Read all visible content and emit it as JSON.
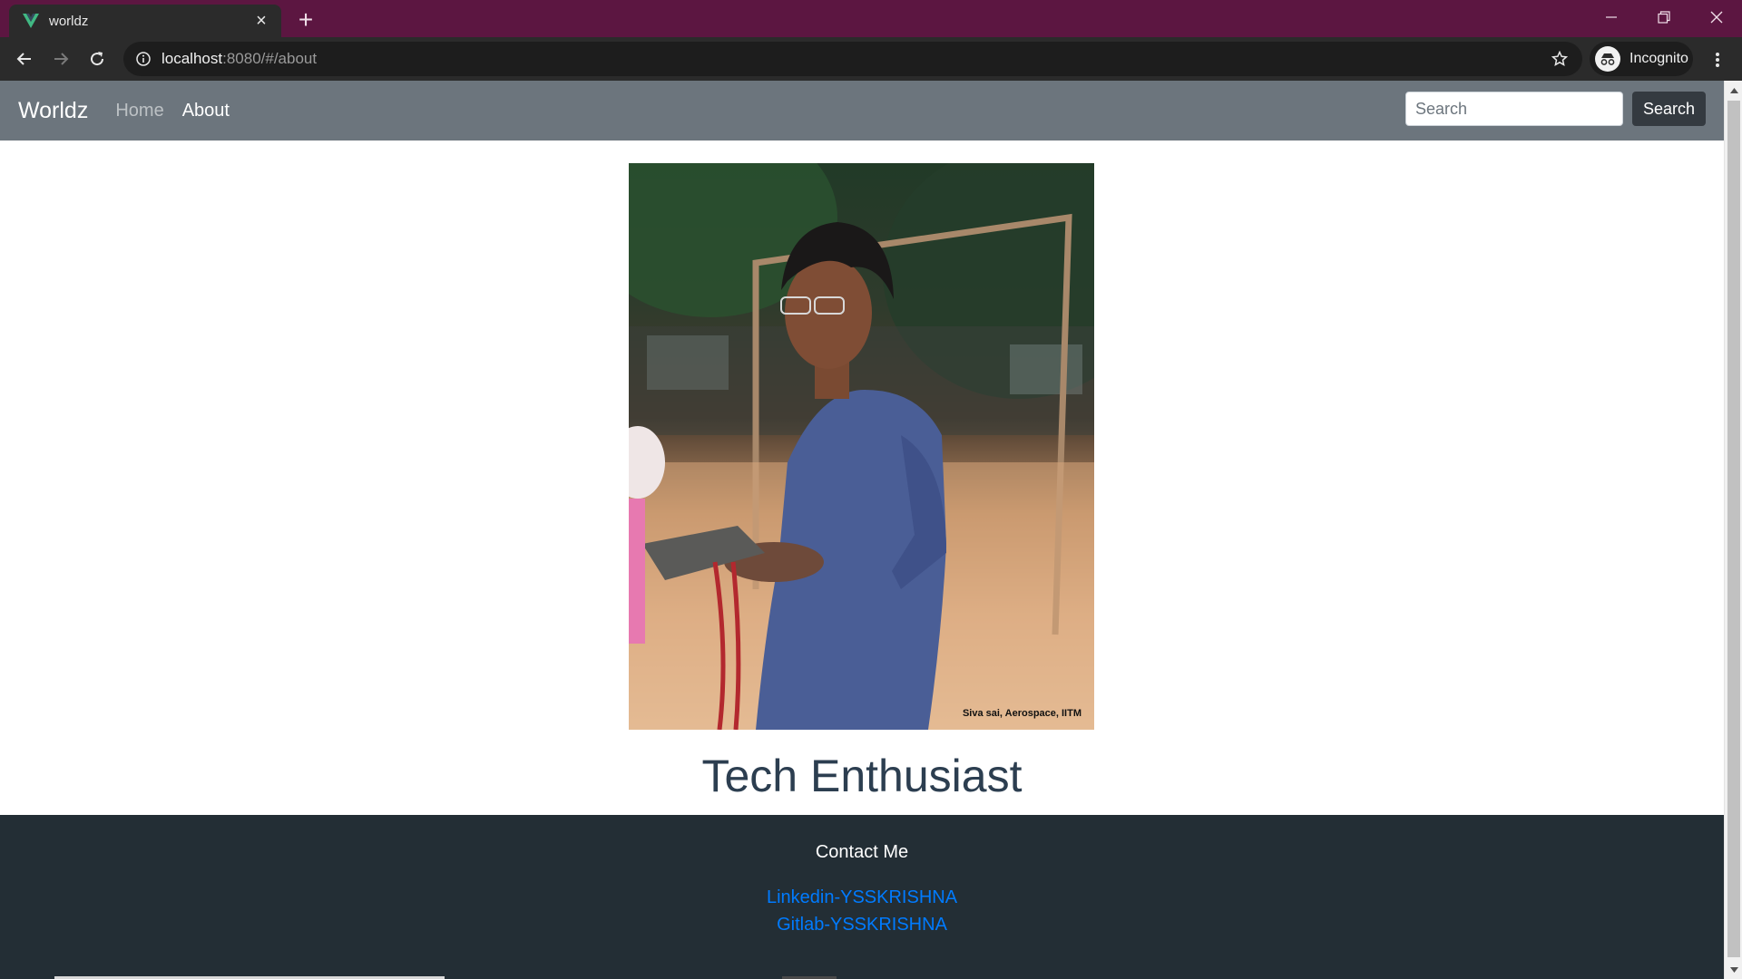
{
  "browser": {
    "tab_title": "worldz",
    "url_host": "localhost",
    "url_path": ":8080/#/about",
    "profile_label": "Incognito"
  },
  "site": {
    "brand": "Worldz",
    "nav": [
      {
        "label": "Home"
      },
      {
        "label": "About"
      }
    ],
    "search": {
      "placeholder": "Search",
      "button_label": "Search"
    }
  },
  "about": {
    "photo_caption": "Siva sai, Aerospace, IITM",
    "tagline": "Tech Enthusiast"
  },
  "footer": {
    "title": "Contact Me",
    "links": [
      {
        "label": "Linkedin-YSSKRISHNA"
      },
      {
        "label": "Gitlab-YSSKRISHNA"
      }
    ]
  },
  "colors": {
    "tabstrip": "#5c1641",
    "navbar": "#6c757d",
    "footer": "#232e35",
    "link": "#007bff",
    "tagline": "#2c3e50"
  }
}
